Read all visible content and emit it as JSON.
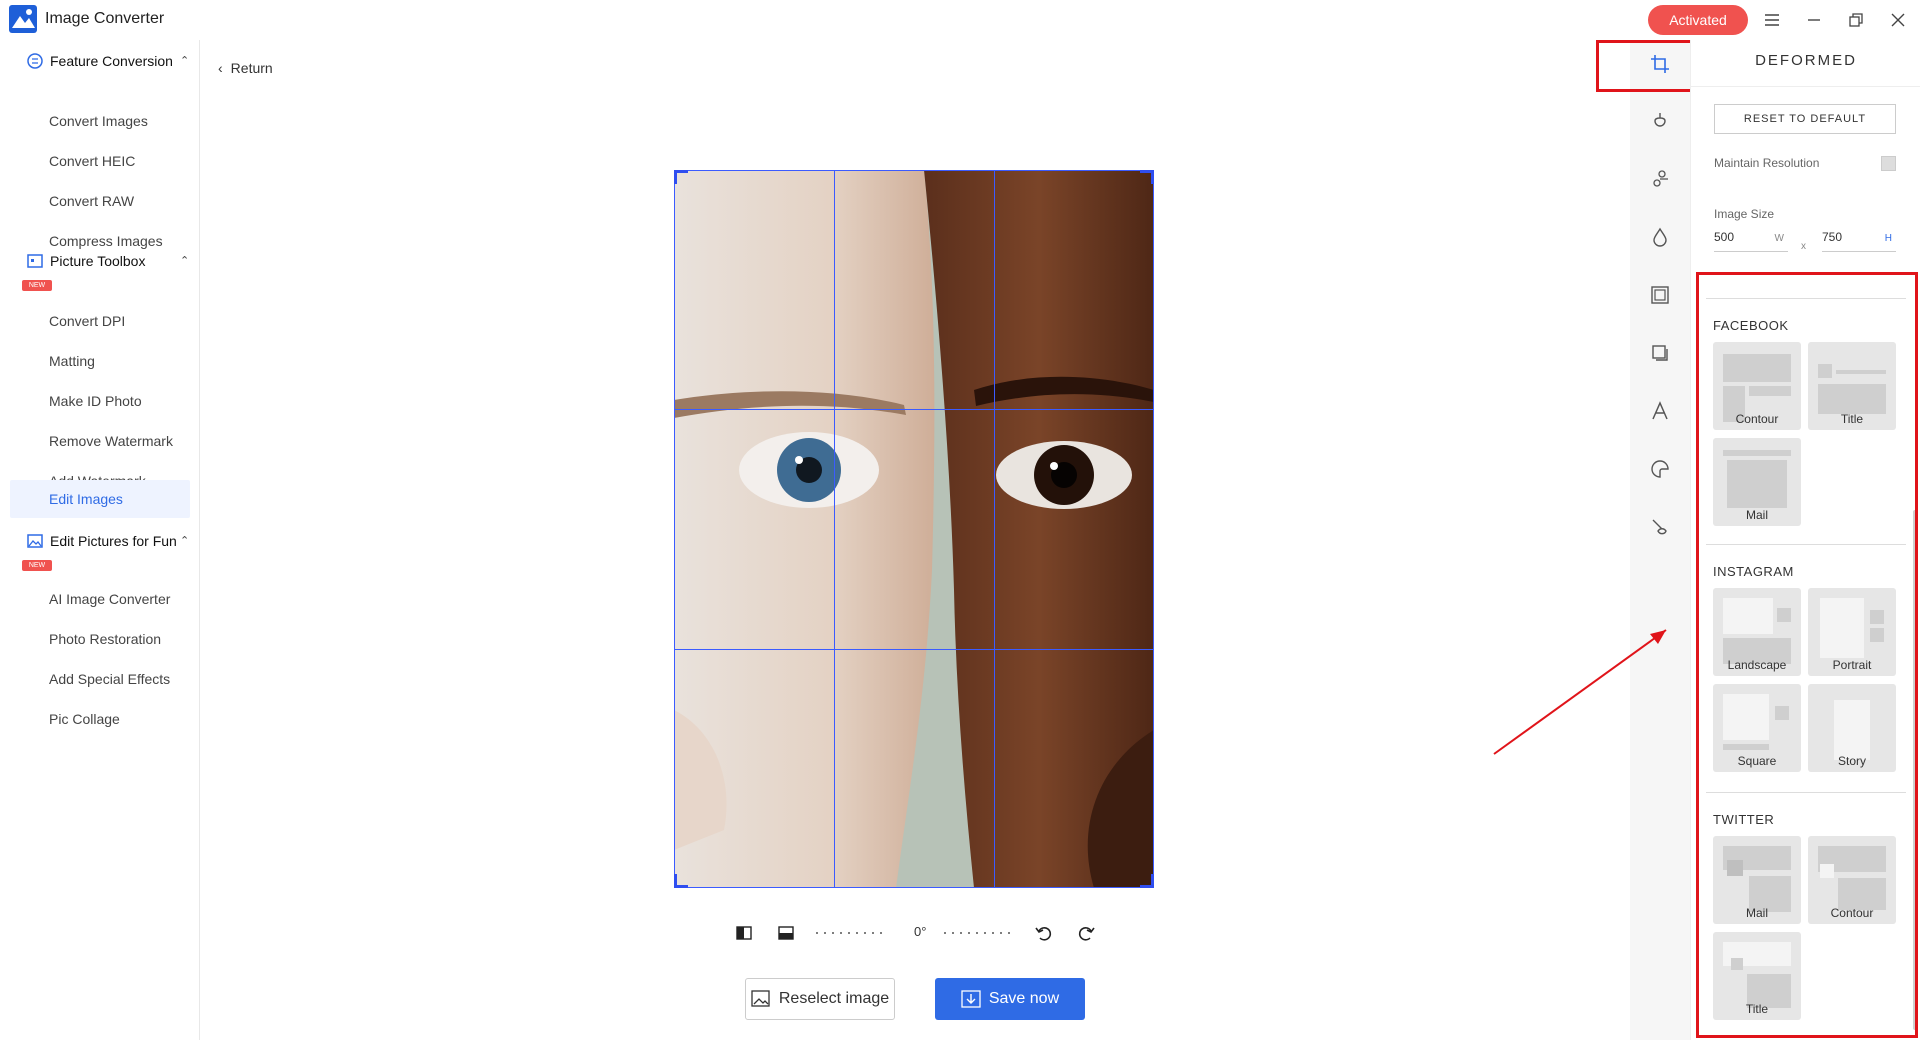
{
  "app": {
    "title": "Image Converter",
    "status_badge": "Activated"
  },
  "window_controls": [
    "menu-icon",
    "minimize-icon",
    "restore-icon",
    "close-icon"
  ],
  "sidebar": {
    "groups": [
      {
        "label": "Feature Conversion",
        "icon": "feature-conversion-icon",
        "items": [
          "Convert Images",
          "Convert HEIC",
          "Convert RAW",
          "Compress Images"
        ]
      },
      {
        "label": "Picture Toolbox",
        "icon": "picture-toolbox-icon",
        "items": [
          "Convert DPI",
          "Matting",
          "Make ID Photo",
          "Remove Watermark",
          "Add Watermark",
          "Edit Images"
        ]
      },
      {
        "label": "Edit Pictures for Fun",
        "icon": "edit-fun-icon",
        "items": [
          "AI Image Converter",
          "Photo Restoration",
          "Add Special Effects",
          "Pic Collage"
        ]
      }
    ],
    "new_badge": "NEW",
    "active_item": "Edit Images"
  },
  "main": {
    "return_label": "Return",
    "rotation": "0°",
    "reselect_label": "Reselect image",
    "save_label": "Save now"
  },
  "rail": {
    "icons": [
      "crop-icon",
      "drop-icon",
      "adjust-icon",
      "droplet-icon",
      "frame-icon",
      "layer-icon",
      "text-icon",
      "sticker-icon",
      "brush-icon"
    ]
  },
  "panel": {
    "title": "DEFORMED",
    "reset_label": "RESET TO DEFAULT",
    "maintain_label": "Maintain Resolution",
    "size_label": "Image Size",
    "width": "500",
    "width_unit": "W",
    "height": "750",
    "height_unit": "H",
    "x_label": "x",
    "sections": [
      {
        "title": "FACEBOOK",
        "presets": [
          "Contour",
          "Title",
          "Mail"
        ]
      },
      {
        "title": "INSTAGRAM",
        "presets": [
          "Landscape",
          "Portrait",
          "Square",
          "Story"
        ]
      },
      {
        "title": "TWITTER",
        "presets": [
          "Mail",
          "Contour",
          "Title"
        ]
      }
    ]
  },
  "colors": {
    "accent": "#2f6be5",
    "badge": "#f0524f",
    "highlight": "#e0141a"
  }
}
